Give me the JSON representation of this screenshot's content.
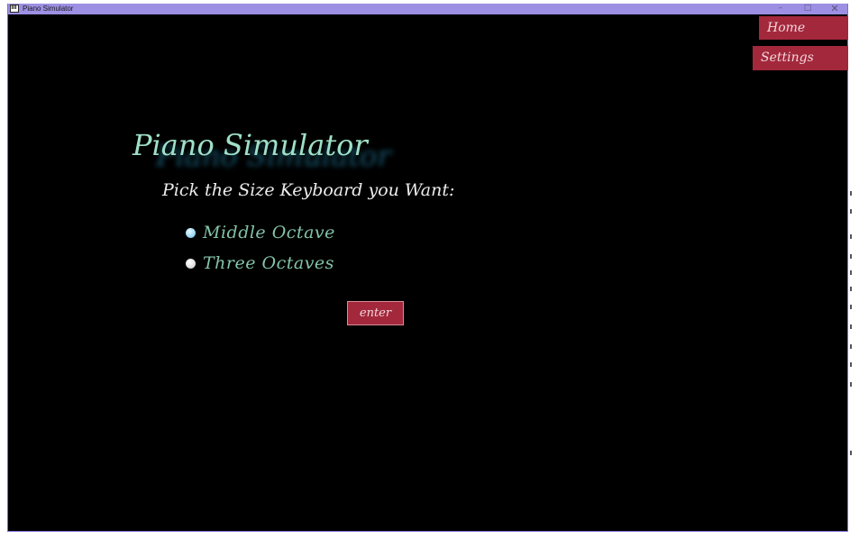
{
  "window": {
    "title": "Piano Simulator",
    "controls": {
      "minimize": "–",
      "maximize": "□",
      "close": "✕"
    }
  },
  "nav": {
    "home_label": "Home",
    "settings_label": "Settings"
  },
  "main": {
    "title": "Piano Simulator",
    "prompt": "Pick the Size Keyboard you Want:",
    "options": [
      {
        "label": "Middle Octave",
        "selected": true
      },
      {
        "label": "Three Octaves",
        "selected": false
      }
    ],
    "enter_label": "enter"
  },
  "colors": {
    "background": "#000000",
    "titlebar": "#9d8fe3",
    "button": "#a3283c",
    "title_text": "#9fe0c6",
    "option_text": "#84c3aa"
  }
}
